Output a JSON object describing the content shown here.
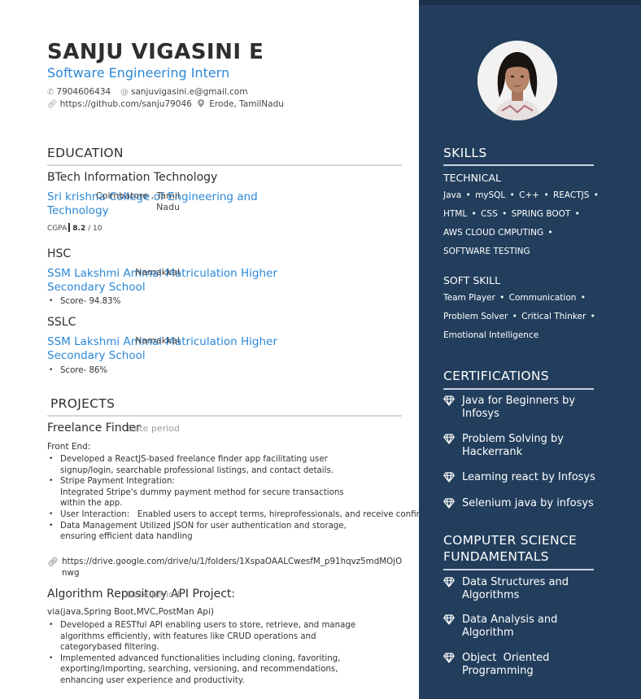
{
  "header": {
    "name": "SANJU VIGASINI E",
    "role": "Software Engineering Intern",
    "phone": "7904606434",
    "email": "sanjuvigasini.e@gmail.com",
    "github": "https://github.com/sanju79046",
    "location": "Erode, TamilNadu"
  },
  "education": {
    "title": "EDUCATION",
    "entries": [
      {
        "degree": "BTech Information Technology",
        "institution": "Sri krishna College of Engineering and Technology",
        "location": "Coimbatore , Tamil Nadu",
        "cgpa_label": "CGPA",
        "cgpa_value": "8.2",
        "cgpa_max": "/ 10"
      },
      {
        "degree": "HSC",
        "institution": "SSM Lakshmi Ammal Matriculation Higher Secondary School",
        "location": "Namakkal",
        "score": "Score- 94.83%"
      },
      {
        "degree": "SSLC",
        "institution": "SSM Lakshmi Ammal Matriculation Higher Secondary School",
        "location": "Namakkal",
        "score": "Score- 86%"
      }
    ]
  },
  "projects": {
    "title": "PROJECTS",
    "items": [
      {
        "name": "Freelance Finder",
        "date": "Date period",
        "subtitle": "Front End:",
        "bullets": [
          "Developed a ReactJS-based freelance finder app facilitating user signup/login, searchable professional listings, and contact details.",
          "Stripe Payment Integration:\nIntegrated Stripe's dummy payment method for secure transactions within the app.",
          "User Interaction:   Enabled users to accept terms, hireprofessionals, and receive confirmation alerts, enhancing user experience",
          "Data Management Utilized JSON for user authentication and storage, ensuring efficient data handling"
        ],
        "link": "https://drive.google.com/drive/u/1/folders/1XspaOAALCwesfM_p91hqvz5mdMOjOnwg"
      },
      {
        "name": "Algorithm Repository API Project:",
        "date": "Date period",
        "subtitle": "via(java,Spring Boot,MVC,PostMan Api)",
        "bullets": [
          "Developed a RESTful API enabling users to store, retrieve, and manage algorithms efficiently, with features like CRUD operations and categorybased filtering.",
          "Implemented advanced functionalities including cloning, favoriting, exporting/importing, searching, versioning, and recommendations, enhancing user experience and productivity."
        ]
      }
    ]
  },
  "sidebar": {
    "skills": {
      "title": "SKILLS",
      "technical_label": "TECHNICAL",
      "technical_lines": [
        [
          "Java",
          "mySQL",
          "C++",
          "REACTJS"
        ],
        [
          "HTML",
          "CSS",
          "SPRING BOOT"
        ],
        [
          "AWS CLOUD CMPUTING"
        ],
        [
          "SOFTWARE TESTING"
        ]
      ],
      "soft_label": "SOFT SKILL",
      "soft_lines": [
        [
          "Team Player",
          "Communication"
        ],
        [
          "Problem Solver",
          "Critical Thinker"
        ],
        [
          "Emotional Intelligence"
        ]
      ]
    },
    "certifications": {
      "title": "CERTIFICATIONS",
      "items": [
        "Java for Beginners by Infosys",
        "Problem Solving by Hackerrank",
        "Learning react by Infosys",
        "Selenium java by infosys"
      ]
    },
    "fundamentals": {
      "title": "COMPUTER SCIENCE FUNDAMENTALS",
      "items": [
        "Data Structures and Algorithms",
        "Data Analysis and Algorithm",
        "Object  Oriented Programming"
      ]
    },
    "colors": {
      "sidebar_bg": "#223e5c",
      "accent": "#2b88d8"
    },
    "icons": {
      "phone": "phone-icon",
      "email": "at-sign-icon",
      "link": "link-icon",
      "location": "location-pin-icon",
      "certification": "diamond-icon"
    }
  }
}
